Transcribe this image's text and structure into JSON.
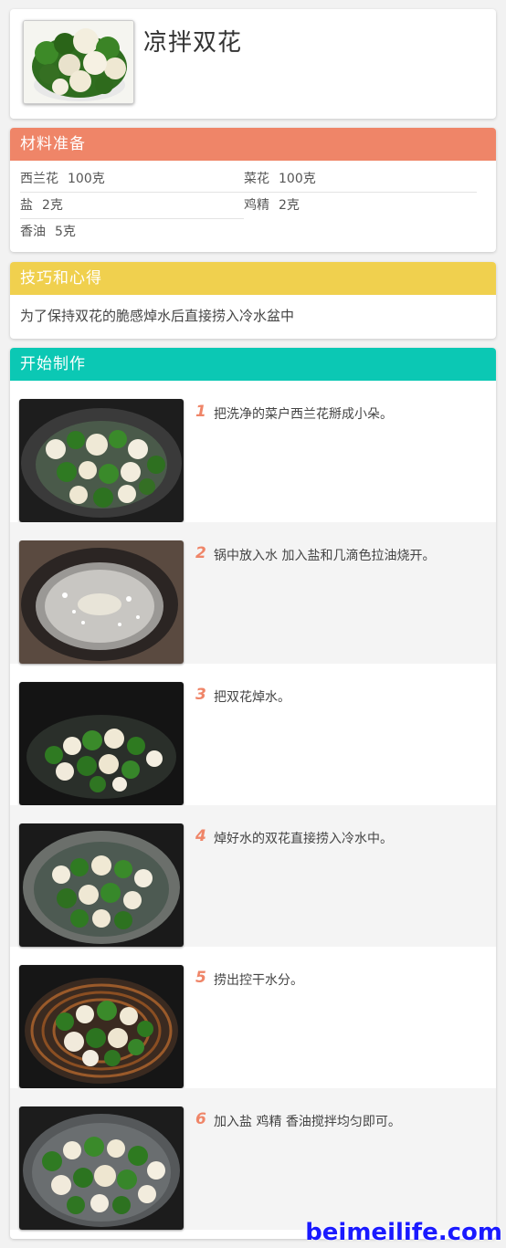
{
  "header": {
    "title": "凉拌双花",
    "thumb_icon": "broccoli-cauliflower-bowl-photo"
  },
  "ingredients": {
    "heading": "材料准备",
    "color": "#ef8568",
    "items": [
      {
        "name": "西兰花",
        "amount": "100克"
      },
      {
        "name": "菜花",
        "amount": "100克"
      },
      {
        "name": "盐",
        "amount": "2克"
      },
      {
        "name": "鸡精",
        "amount": "2克"
      },
      {
        "name": "香油",
        "amount": "5克"
      }
    ]
  },
  "tips": {
    "heading": "技巧和心得",
    "color": "#f0d04e",
    "text": "为了保持双花的脆感焯水后直接捞入冷水盆中"
  },
  "steps": {
    "heading": "开始制作",
    "color": "#0bc8b4",
    "items": [
      {
        "num": "1",
        "text": "把洗净的菜户西兰花掰成小朵。",
        "photo": "florets-in-wok-photo"
      },
      {
        "num": "2",
        "text": "锅中放入水 加入盐和几滴色拉油烧开。",
        "photo": "boiling-water-wok-photo"
      },
      {
        "num": "3",
        "text": "把双花焯水。",
        "photo": "blanching-florets-photo"
      },
      {
        "num": "4",
        "text": "焯好水的双花直接捞入冷水中。",
        "photo": "florets-cold-water-photo"
      },
      {
        "num": "5",
        "text": "捞出控干水分。",
        "photo": "draining-basket-photo"
      },
      {
        "num": "6",
        "text": "加入盐 鸡精 香油搅拌均匀即可。",
        "photo": "mixed-dish-photo"
      }
    ]
  },
  "watermark": "beimeilife.com"
}
